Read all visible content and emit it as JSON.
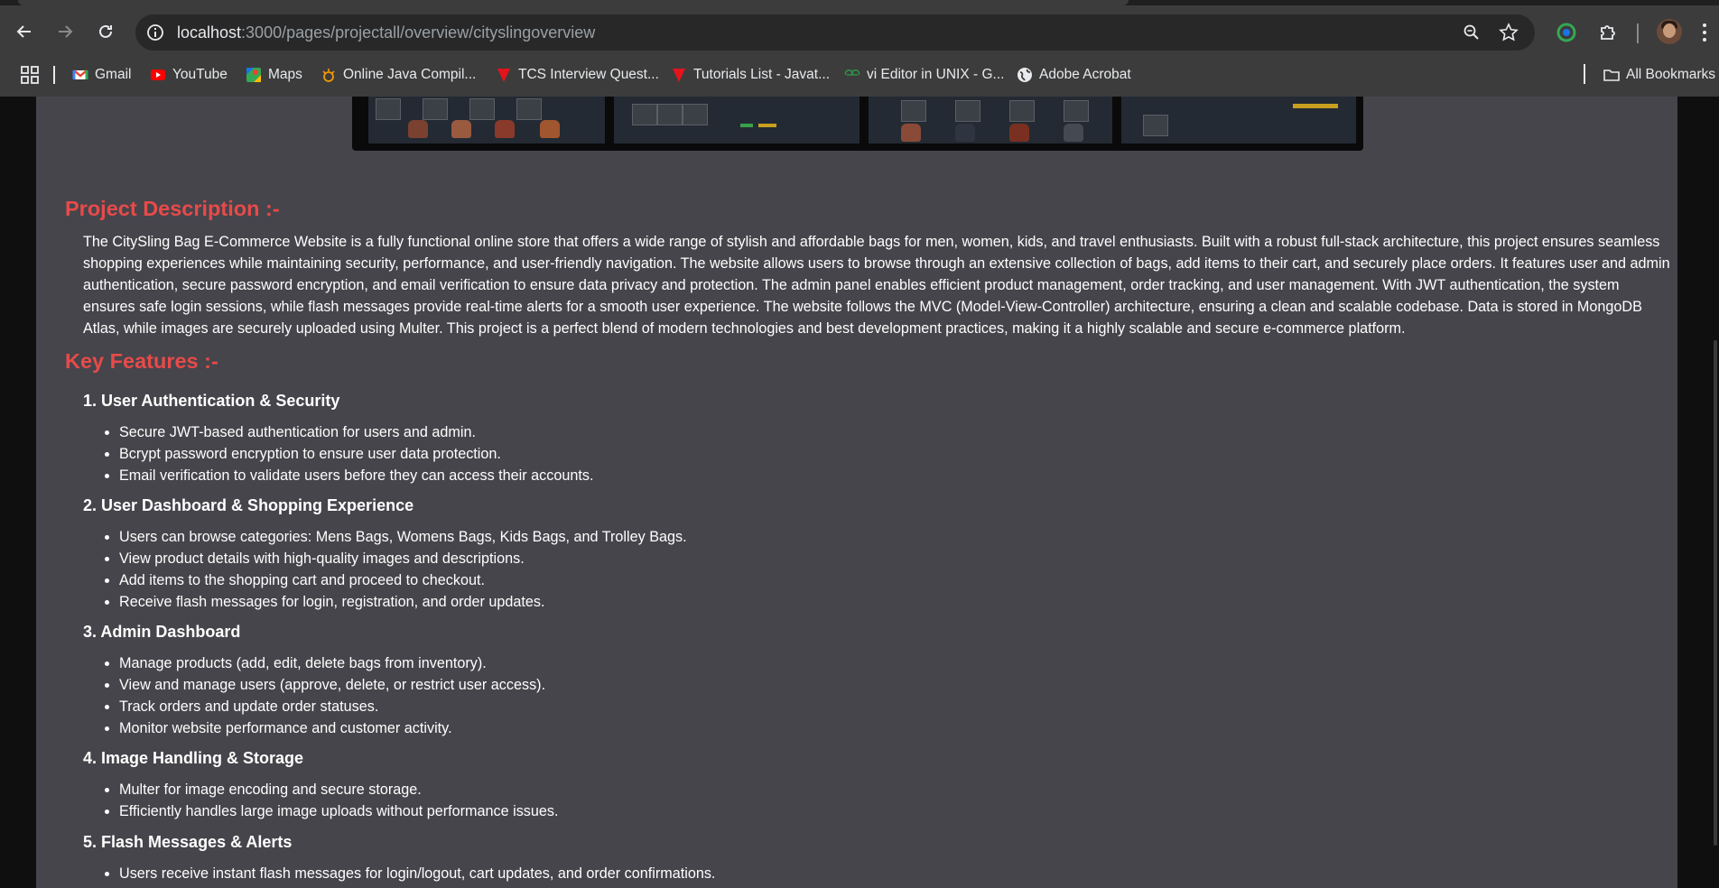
{
  "browser": {
    "url_host": "localhost",
    "url_path": ":3000/pages/projectall/overview/cityslingoverview"
  },
  "bookmarks": {
    "items": [
      {
        "label": "Gmail",
        "icon": "gmail-icon"
      },
      {
        "label": "YouTube",
        "icon": "youtube-icon"
      },
      {
        "label": "Maps",
        "icon": "maps-icon"
      },
      {
        "label": "Online Java Compil...",
        "icon": "compiler-icon"
      },
      {
        "label": "TCS Interview Quest...",
        "icon": "javatpoint-icon"
      },
      {
        "label": "Tutorials List - Javat...",
        "icon": "javatpoint-icon"
      },
      {
        "label": "vi Editor in UNIX - G...",
        "icon": "geeksforgeeks-icon"
      },
      {
        "label": "Adobe Acrobat",
        "icon": "globe-icon"
      }
    ],
    "all_bookmarks": "All Bookmarks"
  },
  "page": {
    "description_heading": "Project Description :-",
    "description": "The CitySling Bag E-Commerce Website is a fully functional online store that offers a wide range of stylish and affordable bags for men, women, kids, and travel enthusiasts. Built with a robust full-stack architecture, this project ensures seamless shopping experiences while maintaining security, performance, and user-friendly navigation. The website allows users to browse through an extensive collection of bags, add items to their cart, and securely place orders. It features user and admin authentication, secure password encryption, and email verification to ensure data privacy and protection. The admin panel enables efficient product management, order tracking, and user management. With JWT authentication, the system ensures safe login sessions, while flash messages provide real-time alerts for a smooth user experience. The website follows the MVC (Model-View-Controller) architecture, ensuring a clean and scalable codebase. Data is stored in MongoDB Atlas, while images are securely uploaded using Multer. This project is a perfect blend of modern technologies and best development practices, making it a highly scalable and secure e-commerce platform.",
    "features_heading": "Key Features :-",
    "sections": [
      {
        "title": "1. User Authentication & Security",
        "items": [
          "Secure JWT-based authentication for users and admin.",
          "Bcrypt password encryption to ensure user data protection.",
          "Email verification to validate users before they can access their accounts."
        ]
      },
      {
        "title": "2. User Dashboard & Shopping Experience",
        "items": [
          "Users can browse categories: Mens Bags, Womens Bags, Kids Bags, and Trolley Bags.",
          "View product details with high-quality images and descriptions.",
          "Add items to the shopping cart and proceed to checkout.",
          "Receive flash messages for login, registration, and order updates."
        ]
      },
      {
        "title": "3. Admin Dashboard",
        "items": [
          "Manage products (add, edit, delete bags from inventory).",
          "View and manage users (approve, delete, or restrict user access).",
          "Track orders and update order statuses.",
          "Monitor website performance and customer activity."
        ]
      },
      {
        "title": "4. Image Handling & Storage",
        "items": [
          "Multer for image encoding and secure storage.",
          "Efficiently handles large image uploads without performance issues."
        ]
      },
      {
        "title": "5. Flash Messages & Alerts",
        "items": [
          "Users receive instant flash messages for login/logout, cart updates, and order confirmations."
        ]
      }
    ]
  },
  "colors": {
    "heading_red": "#e84a4a",
    "content_bg": "#45454b",
    "chrome_bg": "#3c3c3c"
  }
}
